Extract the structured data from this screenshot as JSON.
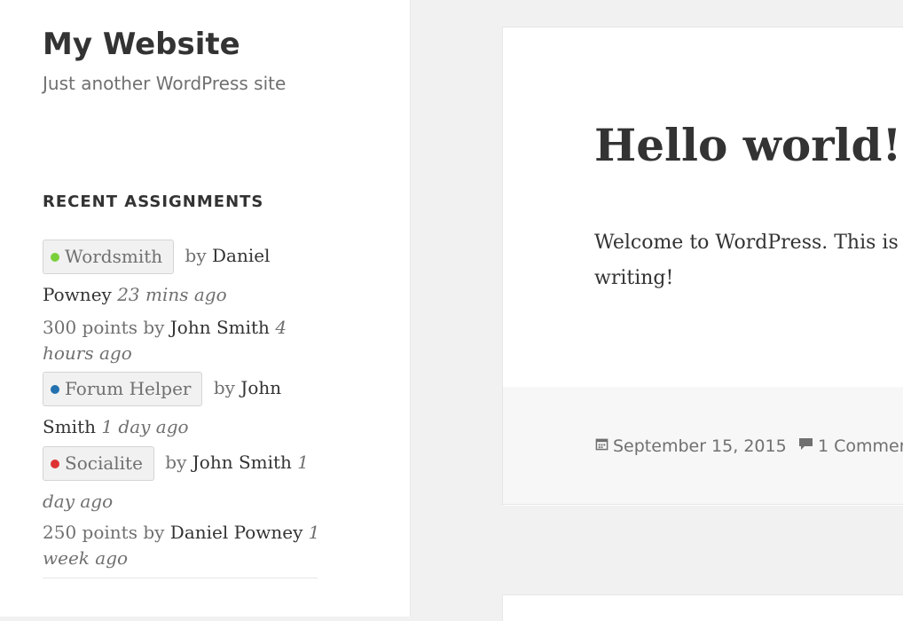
{
  "site": {
    "title": "My Website",
    "tagline": "Just another WordPress site"
  },
  "widget": {
    "title": "RECENT ASSIGNMENTS",
    "by": "by",
    "assignments": [
      {
        "badge": "Wordsmith",
        "badge_color": "#7ad03a",
        "user_first": "Daniel",
        "user_rest": "Powney",
        "time": "23 mins ago"
      },
      {
        "points": "300 points",
        "user": "John Smith",
        "time_first": "4",
        "time_rest": "hours ago"
      },
      {
        "badge": "Forum Helper",
        "badge_color": "#2271b1",
        "user_first": "John",
        "user_rest": "Smith",
        "time": "1 day ago"
      },
      {
        "badge": "Socialite",
        "badge_color": "#dd3333",
        "user": "John Smith",
        "time_first": "1",
        "time_rest": "day ago"
      },
      {
        "points": "250 points",
        "user": "Daniel Powney",
        "time_first": "1",
        "time_rest": "week ago"
      }
    ]
  },
  "post": {
    "title": "Hello world!",
    "body_line1": "Welcome to WordPress. This is",
    "body_line2": "writing!",
    "date": "September 15, 2015",
    "comments": "1 Commen"
  },
  "icons": {
    "date": "calendar-icon",
    "comments": "comment-bubble-icon"
  },
  "colors": {
    "text": "#333333",
    "muted": "#707070",
    "background": "#f1f1f1",
    "card": "#ffffff",
    "footer": "#f7f7f7"
  }
}
